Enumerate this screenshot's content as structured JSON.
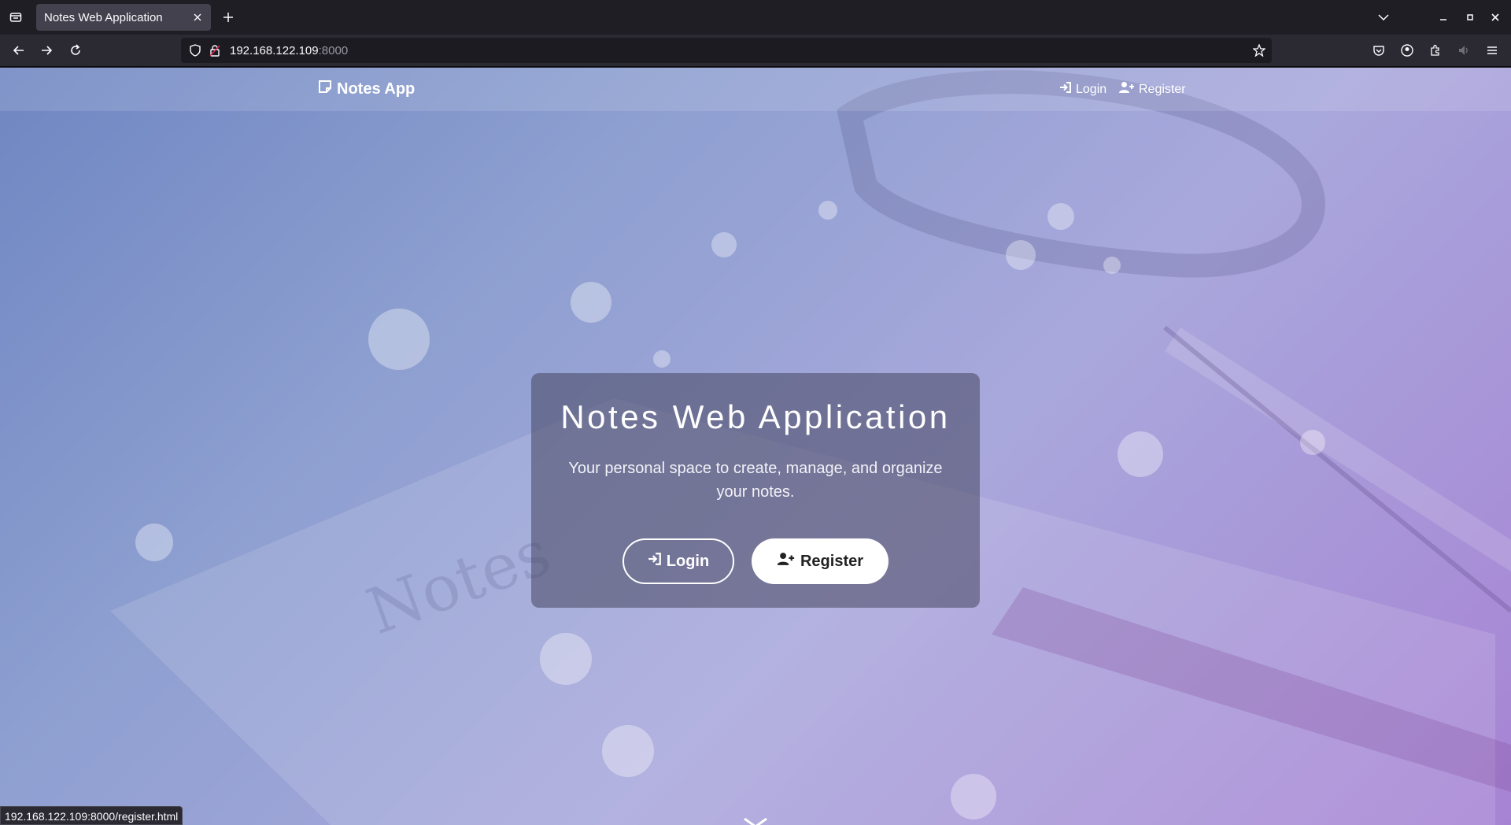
{
  "browser": {
    "tab_title": "Notes Web Application",
    "url_host": "192.168.122.109",
    "url_port": ":8000",
    "status_url": "192.168.122.109:8000/register.html"
  },
  "site": {
    "brand": "Notes App",
    "nav_login": "Login",
    "nav_register": "Register"
  },
  "hero": {
    "title": "Notes Web Application",
    "subtitle": "Your personal space to create, manage, and organize your notes.",
    "login_label": "Login",
    "register_label": "Register"
  },
  "colors": {
    "accent": "#ffffff",
    "gradient_start": "#6f86c2",
    "gradient_end": "#a783d4"
  },
  "icons": [
    "tab-list-icon",
    "close-icon",
    "plus-icon",
    "back-icon",
    "forward-icon",
    "reload-icon",
    "shield-icon",
    "lock-icon",
    "star-icon",
    "pocket-icon",
    "account-icon",
    "extensions-icon",
    "speaker-icon",
    "menu-icon",
    "note-icon",
    "login-icon",
    "user-plus-icon",
    "chevron-down-icon"
  ]
}
